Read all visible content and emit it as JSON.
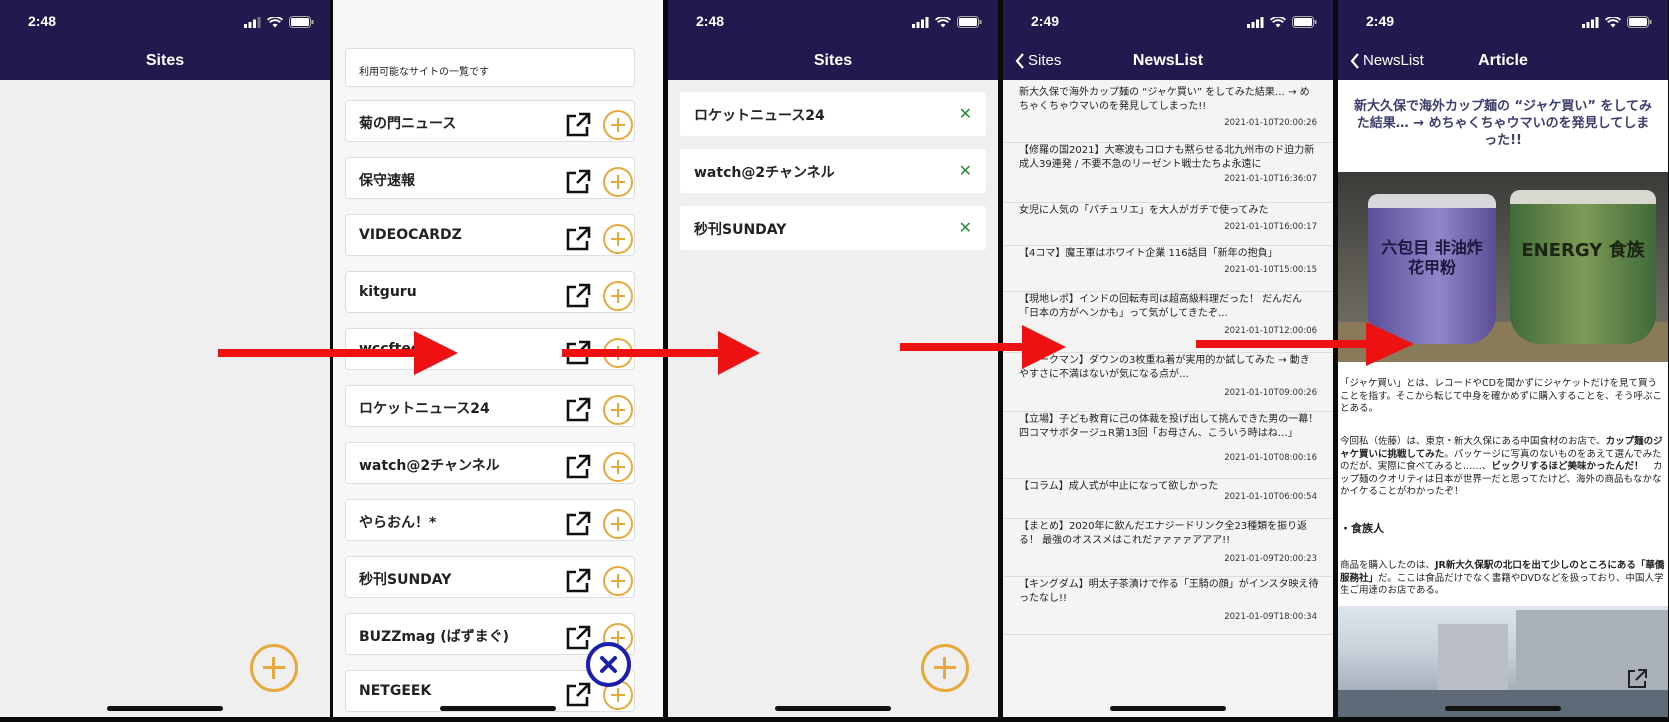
{
  "status": {
    "time1": "2:48",
    "time2": "2:48",
    "time3": "2:49",
    "time4": "2:49"
  },
  "screen1": {
    "title": "Sites"
  },
  "screen2": {
    "header_text": "利用可能なサイトの一覧です",
    "sites": [
      "菊の門ニュース",
      "保守速報",
      "VIDEOCARDZ",
      "kitguru",
      "wccftech",
      "ロケットニュース24",
      "watch@2チャンネル",
      "やらおん！*",
      "秒刊SUNDAY",
      "BUZZmag (ばずまぐ)",
      "NETGEEK"
    ]
  },
  "screen3": {
    "title": "Sites",
    "selected": [
      "ロケットニュース24",
      "watch@2チャンネル",
      "秒刊SUNDAY"
    ]
  },
  "screen4": {
    "back": "Sites",
    "title": "NewsList",
    "items": [
      {
        "title": "新大久保で海外カップ麺の “ジャケ買い” をしてみた結果… → めちゃくちゃウマいのを発見してしまった!!",
        "date": "2021-01-10T20:00:26"
      },
      {
        "title": "【修羅の国2021】大寒波もコロナも黙らせる北九州市のド迫力新成人39連発 / 不要不急のリーゼント戦士たちよ永遠に",
        "date": "2021-01-10T16:36:07"
      },
      {
        "title": "女児に人気の「パチュリエ」を大人がガチで使ってみた",
        "date": "2021-01-10T16:00:17"
      },
      {
        "title": "【4コマ】魔王軍はホワイト企業 116話目「新年の抱負」",
        "date": "2021-01-10T15:00:15"
      },
      {
        "title": "【現地レポ】インドの回転寿司は超高級料理だった！ だんだん「日本の方がヘンかも」って気がしてきたぞ…",
        "date": "2021-01-10T12:00:06"
      },
      {
        "title": "【ワークマン】ダウンの3枚重ね着が実用的か試してみた → 動きやすさに不満はないが気になる点が…",
        "date": "2021-01-10T09:00:26"
      },
      {
        "title": "【立場】子ども教育に己の体裁を投げ出して挑んできた男の一幕！ 四コマサボタージュR第13回「お母さん、こういう時はね…」",
        "date": "2021-01-10T08:00:16"
      },
      {
        "title": "【コラム】成人式が中止になって欲しかった",
        "date": "2021-01-10T06:00:54"
      },
      {
        "title": "【まとめ】2020年に飲んだエナジードリンク全23種類を振り返る！ 最強のオススメはこれだァァァァアアア!!",
        "date": "2021-01-09T20:00:23"
      },
      {
        "title": "【キングダム】明太子茶漬けで作る「王騎の顔」がインスタ映え待ったなし!!",
        "date": "2021-01-09T18:00:34"
      }
    ]
  },
  "screen5": {
    "back": "NewsList",
    "title": "Article",
    "headline": "新大久保で海外カップ麺の “ジャケ買い” をしてみた結果… → めちゃくちゃウマいのを発見してしまった!!",
    "cup_label_left": "六包目 非油炸 花甲粉",
    "cup_label_right": "ENERGY 食族",
    "p1": "「ジャケ買い」とは、レコードやCDを聞かずにジャケットだけを見て買うことを指す。そこから転じて中身を確かめずに購入することを、そう呼ぶことある。",
    "p2a": "今回私（佐藤）は、東京・新大久保にある中国食材のお店で、",
    "p2b": "カップ麺のジャケ買いに挑戦してみた",
    "p2c": "。パッケージに写真のないものをあえて選んでみたのだが、実際に食べてみると……、",
    "p2d": "ビックリするほど美味かったんだ！",
    "p2e": "　カップ麺のクオリティは日本が世界一だと思ってたけど、海外の商品もなかなかイケることがわかったぞ！",
    "section": "・食族人",
    "p3a": "商品を購入したのは、",
    "p3b": "JR新大久保駅の北口を出て少しのところにある「華僑服務社」",
    "p3c": "だ。ここは食品だけでなく書籍やDVDなどを扱っており、中国人学生ご用達のお店である。"
  },
  "colors": {
    "nav": "#24194f",
    "accent": "#e9a83a",
    "arrow": "#ee1111",
    "close": "#2e8b3a",
    "fab_blue": "#1a1fb0"
  }
}
